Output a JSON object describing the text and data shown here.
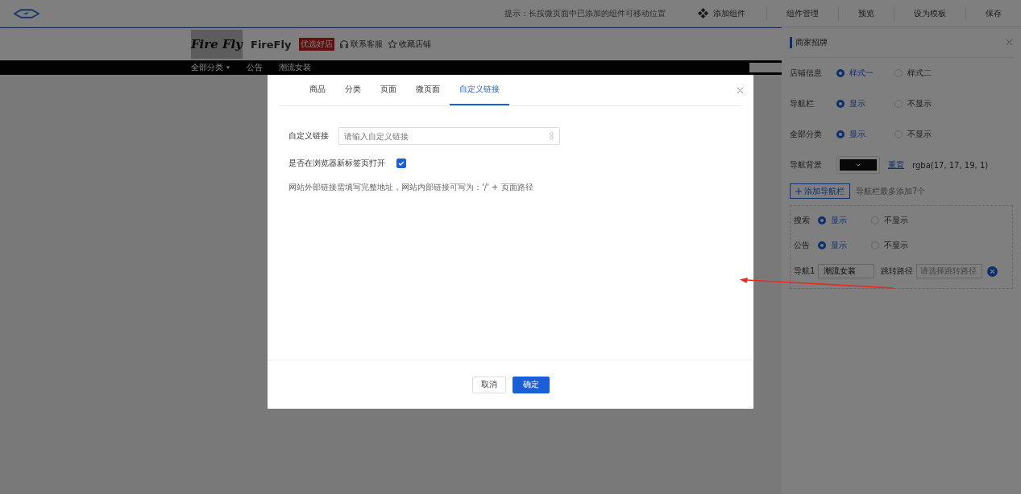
{
  "topbar": {
    "hint": "提示：长按微页面中已添加的组件可移动位置",
    "add_component": "添加组件",
    "buttons": [
      "组件管理",
      "预览",
      "设为模板",
      "保存"
    ]
  },
  "store_preview": {
    "logo_text": "Fire Fly",
    "name": "FireFly",
    "badge": "优选好店",
    "links": [
      {
        "label": "联系客服",
        "kind": "headset"
      },
      {
        "label": "收藏店铺",
        "kind": "star"
      }
    ],
    "nav": [
      {
        "label": "全部分类",
        "dropdown": true
      },
      {
        "label": "公告",
        "dropdown": false
      },
      {
        "label": "潮流女装",
        "dropdown": false
      }
    ]
  },
  "right_panel": {
    "title": "商家招牌",
    "rows": [
      {
        "label": "店铺信息",
        "options": [
          {
            "label": "样式一",
            "selected": true
          },
          {
            "label": "样式二",
            "selected": false
          }
        ]
      },
      {
        "label": "导航栏",
        "options": [
          {
            "label": "显示",
            "selected": true
          },
          {
            "label": "不显示",
            "selected": false
          }
        ]
      },
      {
        "label": "全部分类",
        "options": [
          {
            "label": "显示",
            "selected": true
          },
          {
            "label": "不显示",
            "selected": false
          }
        ]
      }
    ],
    "nav_background": {
      "label": "导航背景",
      "color": "#111113",
      "reset": "重置",
      "value": "rgba(17, 17, 19, 1)"
    },
    "add_nav": {
      "label": "添加导航栏",
      "hint": "导航栏最多添加7个"
    },
    "sub_rows": [
      {
        "label": "搜索",
        "options": [
          {
            "label": "显示",
            "selected": true
          },
          {
            "label": "不显示",
            "selected": false
          }
        ]
      },
      {
        "label": "公告",
        "options": [
          {
            "label": "显示",
            "selected": true
          },
          {
            "label": "不显示",
            "selected": false
          }
        ]
      }
    ],
    "nav_item": {
      "label": "导航1",
      "value": "潮流女装",
      "path_label": "跳转路径",
      "path_placeholder": "请选择跳转路径"
    }
  },
  "modal": {
    "tabs": [
      {
        "label": "商品",
        "selected": false
      },
      {
        "label": "分类",
        "selected": false
      },
      {
        "label": "页面",
        "selected": false
      },
      {
        "label": "微页面",
        "selected": false
      },
      {
        "label": "自定义链接",
        "selected": true
      }
    ],
    "field": {
      "label": "自定义链接",
      "placeholder": "请输入自定义链接"
    },
    "checkbox": {
      "label": "是否在浏览器新标签页打开",
      "checked": true
    },
    "note": "网站外部链接需填写完整地址，网站内部链接可写为：'/' + 页面路径",
    "buttons": [
      {
        "label": "取消",
        "kind": "secondary"
      },
      {
        "label": "确定",
        "kind": "primary"
      }
    ]
  }
}
